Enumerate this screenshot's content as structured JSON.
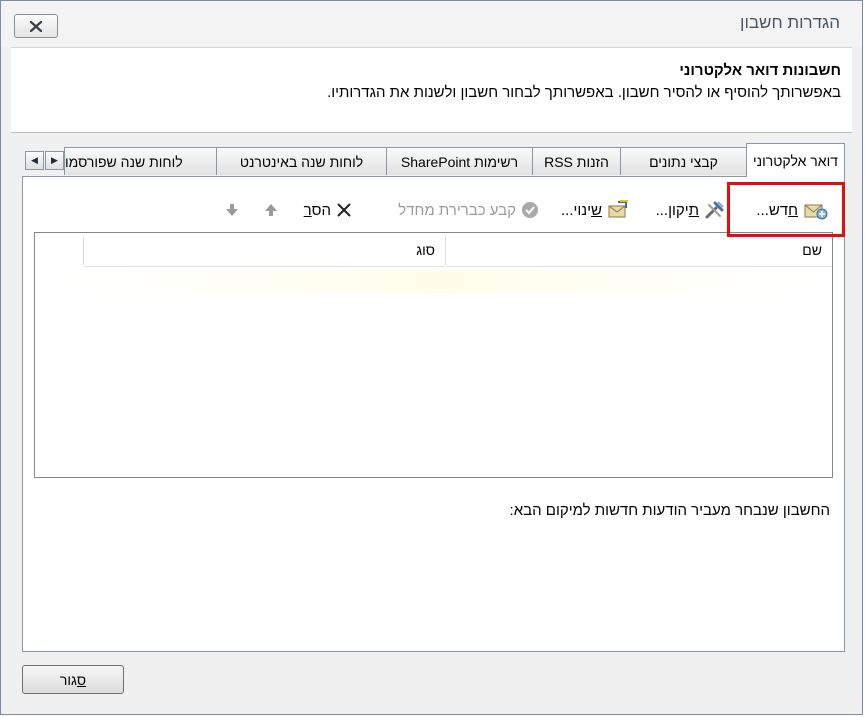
{
  "window": {
    "title": "הגדרות חשבון"
  },
  "header": {
    "title": "חשבונות דואר אלקטרוני",
    "description": "באפשרותך להוסיף או להסיר חשבון. באפשרותך לבחור חשבון ולשנות את הגדרותיו."
  },
  "tabs": [
    {
      "label": "דואר אלקטרוני",
      "active": true
    },
    {
      "label": "קבצי נתונים"
    },
    {
      "label": "הזנות RSS"
    },
    {
      "label": "רשימות SharePoint"
    },
    {
      "label": "לוחות שנה באינטרנט"
    },
    {
      "label": "לוחות שנה שפורסמו"
    }
  ],
  "toolbar": {
    "new_prefix": "ח",
    "new_rest": "דש...",
    "repair_prefix": "ת",
    "repair_rest": "יקון...",
    "change_prefix": "ש",
    "change_rest": "ינוי...",
    "set_default": "קבע כברירת מחדל",
    "remove_prefix": "הס",
    "remove_key": "ר"
  },
  "list": {
    "columns": [
      "שם",
      "סוג"
    ]
  },
  "deliver_label": "החשבון שנבחר מעביר הודעות חדשות למיקום הבא:",
  "footer": {
    "close_key": "ס",
    "close_rest": "גור"
  },
  "colors": {
    "highlight": "#e01010"
  }
}
